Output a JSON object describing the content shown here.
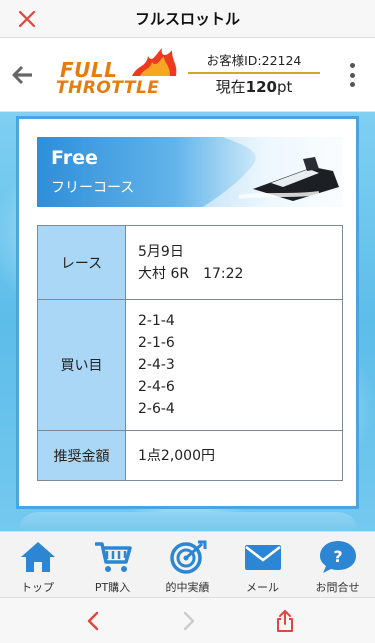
{
  "titlebar": {
    "title": "フルスロットル"
  },
  "header": {
    "logo": {
      "line1": "FULL",
      "line2": "THROTTLE"
    },
    "account": {
      "id_text": "お客様ID:22124",
      "points_prefix": "現在",
      "points_value": "120",
      "points_unit": "pt"
    }
  },
  "banner": {
    "title": "Free",
    "subtitle": "フリーコース"
  },
  "info_table": {
    "rows": [
      {
        "label": "レース",
        "lines": [
          "5月9日",
          "大村 6R　17:22"
        ]
      },
      {
        "label": "買い目",
        "lines": [
          "2-1-4",
          "2-1-6",
          "2-4-3",
          "2-4-6",
          "2-6-4"
        ]
      },
      {
        "label": "推奨金額",
        "lines": [
          "1点2,000円"
        ]
      }
    ]
  },
  "bottom_nav": {
    "items": [
      {
        "label": "トップ",
        "icon": "home-icon"
      },
      {
        "label": "PT購入",
        "icon": "cart-icon"
      },
      {
        "label": "的中実績",
        "icon": "target-icon"
      },
      {
        "label": "メール",
        "icon": "mail-icon"
      },
      {
        "label": "お問合せ",
        "icon": "help-icon"
      }
    ]
  },
  "colors": {
    "accent_blue": "#2d86d3",
    "logo_orange": "#e77c0e",
    "close_red": "#e2453c",
    "table_header": "#a9d7f5"
  }
}
